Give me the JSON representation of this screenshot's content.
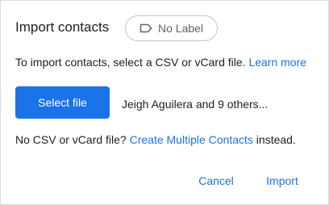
{
  "dialog": {
    "title": "Import contacts",
    "label_chip": {
      "icon": "label-icon",
      "label": "No Label"
    },
    "info": {
      "text": "To import contacts, select a CSV or vCard file.",
      "link": "Learn more"
    },
    "select_button_label": "Select file",
    "selected_file_text": "Jeigh Aguilera and 9 others...",
    "alternative": {
      "prefix": "No CSV or vCard file?",
      "link": "Create Multiple Contacts",
      "suffix": "instead."
    },
    "actions": {
      "cancel_label": "Cancel",
      "import_label": "Import"
    }
  },
  "colors": {
    "accent": "#1a73e8",
    "text": "#202124",
    "muted": "#5f6368",
    "border": "#dadce0"
  }
}
